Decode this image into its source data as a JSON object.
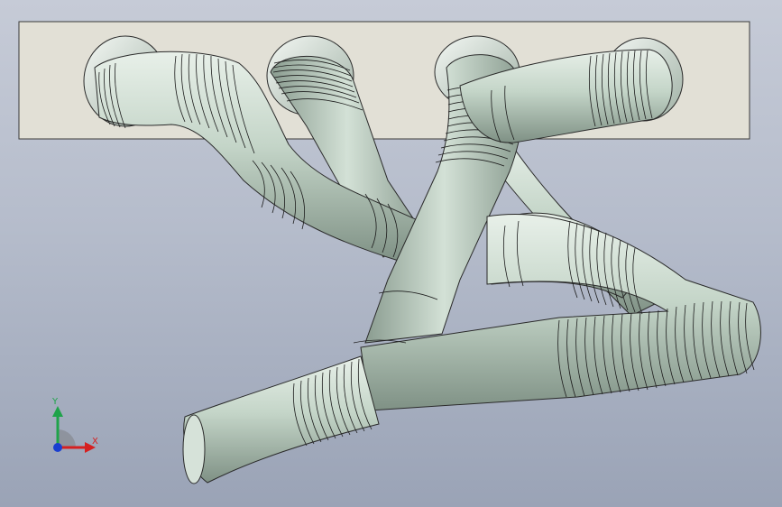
{
  "viewport": {
    "background_top": "#c6cbd7",
    "background_bottom": "#9aa3b6"
  },
  "model": {
    "flange_color": "#e2e0d6",
    "pipe_color": "#bfd1c3",
    "pipe_highlight": "#e8f0e9",
    "pipe_shadow": "#7f9185",
    "port_count": 4
  },
  "triad": {
    "x_label": "X",
    "y_label": "Y",
    "x_color": "#d62020",
    "y_color": "#1fa34a",
    "origin_color": "#1a3fd0"
  }
}
